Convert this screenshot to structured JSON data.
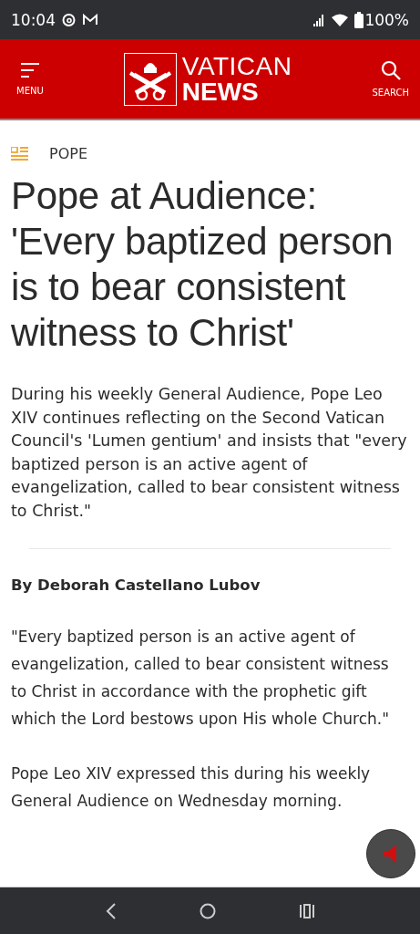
{
  "status_bar": {
    "time": "10:04",
    "battery": "100%"
  },
  "header": {
    "menu_label": "MENU",
    "logo_top": "VATICAN",
    "logo_bottom": "NEWS",
    "search_label": "SEARCH"
  },
  "article": {
    "category": "POPE",
    "title": "Pope at Audience: 'Every baptized person is to bear consistent witness to Christ'",
    "summary": "During his weekly General Audience, Pope Leo XIV continues reflecting on the Second Vatican Council's 'Lumen gentium' and insists that \"every baptized person is an active agent of evangelization, called to bear consistent witness to Christ.\"",
    "byline": "By Deborah Castellano Lubov",
    "paragraphs": [
      "\"Every baptized person is an active agent of evangelization, called to bear consistent witness to Christ in accordance with the prophetic gift which the Lord bestows upon His whole Church.\"",
      "Pope Leo XIV expressed this during his weekly General Audience on Wednesday morning."
    ]
  }
}
